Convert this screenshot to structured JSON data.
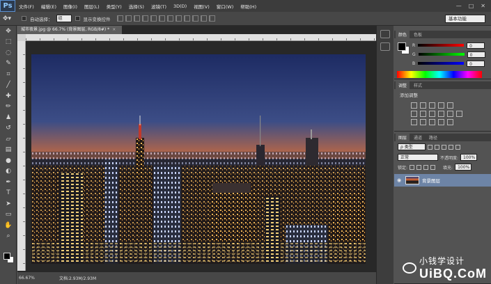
{
  "app": {
    "logo": "Ps"
  },
  "menu": [
    "文件(F)",
    "编辑(E)",
    "图像(I)",
    "图层(L)",
    "类型(Y)",
    "选择(S)",
    "滤镜(T)",
    "3D(D)",
    "视图(V)",
    "窗口(W)",
    "帮助(H)"
  ],
  "window_controls": [
    "—",
    "□",
    "✕"
  ],
  "options": {
    "auto_select_label": "自动选择：",
    "auto_select_value": "组",
    "show_transform_label": "显示变换控件",
    "workspace": "基本功能"
  },
  "document": {
    "tab_title": "城市夜景.jpg @ 66.7% (背景图层, RGB/8#) *",
    "tab_close": "×",
    "zoom": "66.67%",
    "doc_info": "文档:2.93M/2.93M"
  },
  "color_panel": {
    "tabs": [
      "颜色",
      "色板"
    ],
    "rows": [
      {
        "channel": "R",
        "value": "0",
        "color": "#e02020"
      },
      {
        "channel": "G",
        "value": "0",
        "color": "#20c020"
      },
      {
        "channel": "B",
        "value": "0",
        "color": "#2040e0"
      }
    ]
  },
  "adjustments_panel": {
    "tabs": [
      "调整",
      "样式"
    ],
    "title": "添加调整"
  },
  "layers_panel": {
    "tabs": [
      "图层",
      "通道",
      "路径"
    ],
    "filter_type": "ρ 类型",
    "blend_mode": "正常",
    "opacity_label": "不透明度:",
    "opacity_value": "100%",
    "lock_label": "锁定:",
    "fill_label": "填充:",
    "fill_value": "100%",
    "layers": [
      {
        "name": "背景图层",
        "visible": true,
        "selected": true
      }
    ]
  },
  "watermark": {
    "line1": "小钱学设计",
    "line2": "UiBQ.CoM"
  },
  "tools": [
    "move-icon",
    "marquee-icon",
    "lasso-icon",
    "quick-select-icon",
    "crop-icon",
    "eyedropper-icon",
    "healing-icon",
    "brush-icon",
    "stamp-icon",
    "history-brush-icon",
    "eraser-icon",
    "gradient-icon",
    "blur-icon",
    "dodge-icon",
    "pen-icon",
    "type-icon",
    "path-select-icon",
    "shape-icon",
    "hand-icon",
    "zoom-icon"
  ]
}
